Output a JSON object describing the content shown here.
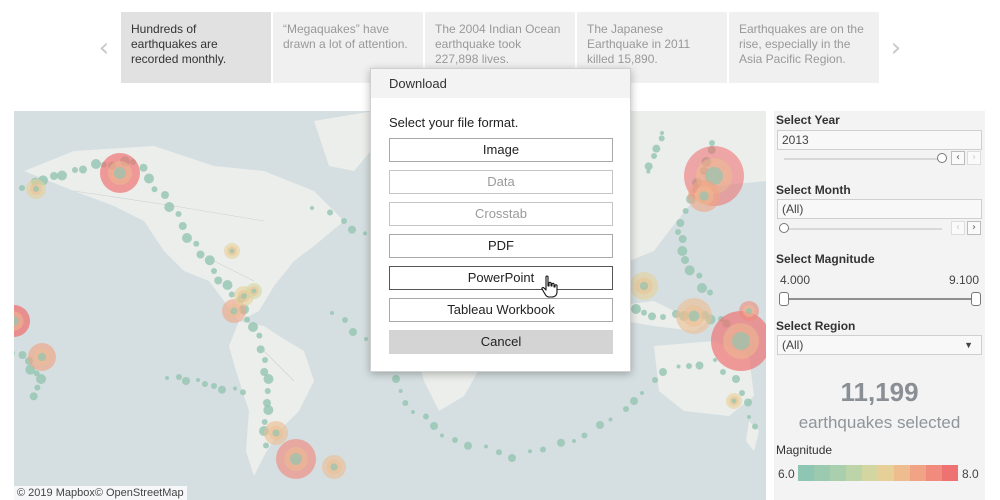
{
  "story": {
    "prev_icon": "chevron-left-icon",
    "next_icon": "chevron-right-icon",
    "points": [
      {
        "text": "Hundreds of earthquakes are recorded monthly.",
        "active": true
      },
      {
        "text": "“Megaquakes” have drawn a lot of attention.",
        "active": false
      },
      {
        "text": "The 2004 Indian Ocean earthquake took 227,898 lives.",
        "active": false
      },
      {
        "text": "The Japanese Earthquake in 2011 killed 15,890.",
        "active": false
      },
      {
        "text": "Earthquakes are on the rise, especially in the Asia Pacific Region.",
        "active": false
      }
    ]
  },
  "map": {
    "attribution": "© 2019 Mapbox© OpenStreetMap",
    "colors": {
      "water": "#d5dfe1",
      "land": "#eceeeb",
      "small_quake": "#93c4b1",
      "large_quake": "#ef6b6b"
    }
  },
  "dialog": {
    "title": "Download",
    "prompt": "Select your file format.",
    "options": [
      {
        "label": "Image",
        "enabled": true
      },
      {
        "label": "Data",
        "enabled": false
      },
      {
        "label": "Crosstab",
        "enabled": false
      },
      {
        "label": "PDF",
        "enabled": true
      },
      {
        "label": "PowerPoint",
        "enabled": true,
        "hovered": true
      },
      {
        "label": "Tableau Workbook",
        "enabled": true
      }
    ],
    "cancel_label": "Cancel"
  },
  "filters": {
    "year": {
      "title": "Select Year",
      "value": "2013",
      "slider_position": 1.0
    },
    "month": {
      "title": "Select Month",
      "value": "(All)",
      "slider_position": 0.0
    },
    "magnitude": {
      "title": "Select Magnitude",
      "min": "4.000",
      "max": "9.100"
    },
    "region": {
      "title": "Select Region",
      "value": "(All)"
    }
  },
  "summary": {
    "count": "11,199",
    "caption": "earthquakes selected"
  },
  "legend": {
    "title": "Magnitude",
    "min": "6.0",
    "max": "8.0",
    "colors": [
      "#8ec5b3",
      "#9ccab0",
      "#aacfae",
      "#bdd4a8",
      "#d3d6a0",
      "#e6d098",
      "#edbd8f",
      "#f0a485",
      "#f08b7e",
      "#ee7272"
    ]
  }
}
